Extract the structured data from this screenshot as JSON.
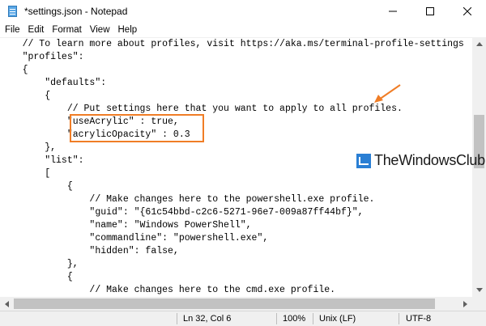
{
  "window": {
    "title": "*settings.json - Notepad",
    "icon": "notepad-icon",
    "controls": [
      "minimize-icon",
      "maximize-icon",
      "close-icon"
    ]
  },
  "menu": {
    "items": [
      "File",
      "Edit",
      "Format",
      "View",
      "Help"
    ]
  },
  "editor": {
    "lines": [
      "    // To learn more about profiles, visit https://aka.ms/terminal-profile-settings",
      "    \"profiles\":",
      "    {",
      "        \"defaults\":",
      "        {",
      "            // Put settings here that you want to apply to all profiles.",
      "            \"useAcrylic\" : true,",
      "            \"acrylicOpacity\" : 0.3",
      "        },",
      "        \"list\":",
      "        [",
      "            {",
      "                // Make changes here to the powershell.exe profile.",
      "                \"guid\": \"{61c54bbd-c2c6-5271-96e7-009a87ff44bf}\",",
      "                \"name\": \"Windows PowerShell\",",
      "                \"commandline\": \"powershell.exe\",",
      "                \"hidden\": false,",
      "            },",
      "            {",
      "                // Make changes here to the cmd.exe profile."
    ]
  },
  "statusbar": {
    "position": "Ln 32, Col 6",
    "zoom": "100%",
    "line_ending": "Unix (LF)",
    "encoding": "UTF-8"
  },
  "annotation": {
    "color": "#f07d26"
  },
  "watermark": {
    "text": "TheWindowsClub"
  }
}
